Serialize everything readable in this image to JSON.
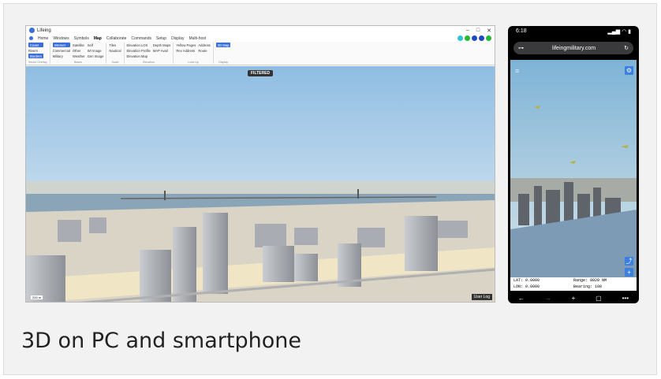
{
  "pc": {
    "title": "Lifeing",
    "window_controls": [
      "–",
      "□",
      "✕"
    ],
    "menu": [
      "Home",
      "Windows",
      "Symbols",
      "Map",
      "Collaborate",
      "Commands",
      "Setup",
      "Display",
      "Multi-host"
    ],
    "active_menu": "Map",
    "ribbon": {
      "groups": [
        {
          "label": "Vector Overlay",
          "items": [
            "Coast",
            "Rivers",
            "Borders"
          ]
        },
        {
          "label": "Bases",
          "items": [
            "Internet",
            "Commercial",
            "Military",
            "Satellite",
            "Other",
            "Weather",
            "Self",
            "WI Image",
            "Gen Image"
          ]
        },
        {
          "label": "Scale",
          "items": [
            "Tiles",
            "Nautical"
          ]
        },
        {
          "label": "Elevation",
          "items": [
            "Elevation LOS",
            "Elevation Profile",
            "Elevation Map",
            "Depth Maps",
            "MAP Avail"
          ]
        },
        {
          "label": "Look Up",
          "items": [
            "Yellow Pages",
            "Rev Address",
            "Address",
            "Route"
          ]
        },
        {
          "label": "Display",
          "items": [
            "3D Map"
          ]
        }
      ]
    },
    "filter_badge": "FILTERED",
    "user_log": "User Log",
    "scale_text": "200 m"
  },
  "phone": {
    "time": "6:18",
    "signal": "▂▄▆ ◠ ▮",
    "url": "lifeingmilitary.com",
    "lat_label": "LAT: 0.0000",
    "lon_label": "LON: 0.0000",
    "range_label": "Range: 8020 NM",
    "bearing_label": "Bearing: 108",
    "nav": [
      "←",
      "→",
      "+",
      "▢",
      "•••"
    ]
  },
  "caption": "3D on PC and smartphone",
  "colors": {
    "accent": "#3b6fd8",
    "sky_top": "#9cc5e6",
    "sky_bottom": "#eef3f4",
    "water": "#8aa4b8",
    "ground": "#d9d4c6"
  }
}
